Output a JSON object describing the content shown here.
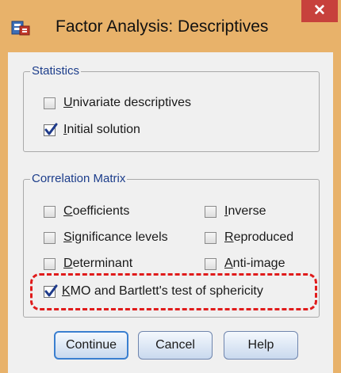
{
  "window": {
    "title": "Factor Analysis: Descriptives",
    "close_label": "✕",
    "colors": {
      "frame": "#e8b26a",
      "close": "#c7413c",
      "legend_text": "#1c3d8b",
      "highlight": "#e01b1b"
    }
  },
  "statistics": {
    "legend": "Statistics",
    "options": [
      {
        "mnemonic": "U",
        "rest": "nivariate descriptives",
        "checked": false
      },
      {
        "mnemonic": "I",
        "rest": "nitial solution",
        "checked": true
      }
    ]
  },
  "correlation_matrix": {
    "legend": "Correlation Matrix",
    "left_options": [
      {
        "mnemonic": "C",
        "rest": "oefficients",
        "checked": false
      },
      {
        "mnemonic": "S",
        "rest": "ignificance levels",
        "checked": false
      },
      {
        "mnemonic": "D",
        "rest": "eterminant",
        "checked": false
      },
      {
        "mnemonic": "K",
        "rest": "MO and Bartlett's test of sphericity",
        "checked": true
      }
    ],
    "right_options": [
      {
        "mnemonic": "I",
        "rest": "nverse",
        "checked": false
      },
      {
        "mnemonic": "R",
        "rest": "eproduced",
        "checked": false
      },
      {
        "mnemonic": "A",
        "rest": "nti-image",
        "checked": false
      }
    ]
  },
  "buttons": {
    "continue": "Continue",
    "cancel": "Cancel",
    "help": "Help"
  },
  "icons": {
    "app": "spss-app-icon",
    "checkmark": "checkmark-icon"
  }
}
